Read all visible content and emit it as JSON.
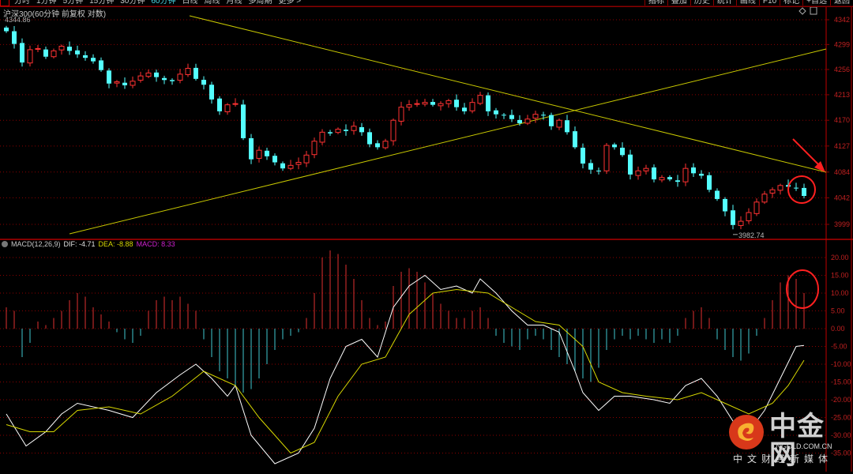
{
  "toolbar": {
    "periods": [
      "分时",
      "1分钟",
      "5分钟",
      "15分钟",
      "30分钟",
      "60分钟",
      "日线",
      "周线",
      "月线",
      "多周期",
      "更多 >"
    ],
    "active_period": "60分钟",
    "right_buttons": [
      "指标",
      "叠加",
      "历史",
      "统计",
      "画线",
      "F10",
      "标记",
      "+自选",
      "返回"
    ]
  },
  "title": "沪深300(60分钟 前复权 对数)",
  "max_label": "4344.86",
  "min_label": "3982.74",
  "macd_legend": {
    "name": "MACD(12,26,9)",
    "dif": "DIF: -4.71",
    "dea": "DEA: -8.88",
    "macd": "MACD: 8.33"
  },
  "logo": {
    "name": "中金网",
    "domain": "CNGOLD.COM.CN",
    "slogan": "中文财经新媒体"
  },
  "colors": {
    "up": "#ff3232",
    "down": "#54ffff",
    "dif": "#ffffff",
    "dea": "#d8d800",
    "grid": "#8b0000",
    "axis_text": "#c02020",
    "trendline": "#c8c800",
    "annotation": "#ff2020"
  },
  "chart_data": [
    {
      "type": "candlestick",
      "title": "沪深300",
      "y_ticks": [
        4342,
        4299,
        4256,
        4213,
        4170,
        4127,
        4084,
        4042,
        3999
      ],
      "ylim": [
        3982,
        4345
      ],
      "y_scale": "log",
      "grid": true,
      "close": [
        4322,
        4300,
        4268,
        4290,
        4292,
        4278,
        4288,
        4296,
        4288,
        4282,
        4276,
        4270,
        4255,
        4232,
        4235,
        4229,
        4236,
        4245,
        4250,
        4243,
        4238,
        4236,
        4248,
        4258,
        4240,
        4230,
        4205,
        4185,
        4196,
        4198,
        4140,
        4105,
        4120,
        4110,
        4100,
        4090,
        4095,
        4100,
        4112,
        4135,
        4150,
        4148,
        4155,
        4152,
        4160,
        4150,
        4130,
        4125,
        4135,
        4170,
        4192,
        4196,
        4198,
        4200,
        4196,
        4198,
        4203,
        4192,
        4185,
        4200,
        4212,
        4185,
        4180,
        4178,
        4172,
        4165,
        4172,
        4180,
        4178,
        4160,
        4170,
        4150,
        4125,
        4098,
        4088,
        4086,
        4128,
        4125,
        4112,
        4080,
        4086,
        4090,
        4072,
        4075,
        4072,
        4068,
        4090,
        4082,
        4078,
        4055,
        4040,
        4020,
        3998,
        4004,
        4018,
        4035,
        4048,
        4055,
        4062,
        4060,
        4058,
        4045
      ]
    },
    {
      "type": "bar+line",
      "title": "MACD(12,26,9)",
      "y_ticks": [
        20,
        15,
        10,
        5,
        0,
        -5,
        -10,
        -15,
        -20,
        -25,
        -30,
        -35
      ],
      "ylim": [
        -40,
        22
      ],
      "macd": [
        6,
        5,
        -8,
        -4,
        2,
        1,
        3,
        5,
        8,
        10,
        9,
        6,
        4,
        2,
        -1,
        -3,
        -4,
        -2,
        5,
        8,
        9,
        8,
        9,
        7,
        5,
        -3,
        -8,
        -12,
        -14,
        -16,
        -18,
        -17,
        -14,
        -10,
        -6,
        -3,
        -2,
        -1,
        3,
        10,
        20,
        22,
        21,
        18,
        14,
        8,
        3,
        1,
        2,
        12,
        16,
        17,
        16,
        13,
        10,
        7,
        5,
        3,
        3,
        5,
        6,
        3,
        -2,
        -4,
        -5,
        -6,
        -3,
        -2,
        -3,
        -6,
        -8,
        -10,
        -12,
        -14,
        -15,
        -11,
        -6,
        -3,
        -2,
        -3,
        -2,
        -3,
        -4,
        -3,
        -4,
        -2,
        3,
        5,
        6,
        3,
        -3,
        -6,
        -8,
        -9,
        -7,
        -2,
        3,
        8,
        13,
        15,
        14,
        10
      ],
      "dif": [
        [
          0,
          -24
        ],
        [
          2.5,
          -33
        ],
        [
          5,
          -29
        ],
        [
          7,
          -24
        ],
        [
          9,
          -21
        ],
        [
          13,
          -23
        ],
        [
          16,
          -25
        ],
        [
          19,
          -18
        ],
        [
          22,
          -13
        ],
        [
          24,
          -10
        ],
        [
          26,
          -14
        ],
        [
          28,
          -19
        ],
        [
          29,
          -16
        ],
        [
          31,
          -30
        ],
        [
          34,
          -38
        ],
        [
          37,
          -35
        ],
        [
          39,
          -28
        ],
        [
          41,
          -14
        ],
        [
          43,
          -5
        ],
        [
          45,
          -3
        ],
        [
          47,
          -8
        ],
        [
          49,
          6
        ],
        [
          51,
          12
        ],
        [
          53,
          15
        ],
        [
          55,
          11
        ],
        [
          57,
          12
        ],
        [
          59,
          10
        ],
        [
          60,
          14
        ],
        [
          62,
          10
        ],
        [
          64,
          5
        ],
        [
          66,
          1
        ],
        [
          68,
          1
        ],
        [
          70,
          -1
        ],
        [
          72,
          -12
        ],
        [
          73,
          -18
        ],
        [
          75,
          -23
        ],
        [
          77,
          -19
        ],
        [
          79,
          -19
        ],
        [
          82,
          -20
        ],
        [
          84,
          -21
        ],
        [
          86,
          -16
        ],
        [
          88,
          -14
        ],
        [
          90,
          -19
        ],
        [
          92,
          -26
        ],
        [
          94,
          -29
        ],
        [
          96,
          -23
        ],
        [
          98,
          -14
        ],
        [
          100,
          -5
        ],
        [
          101,
          -4.71
        ]
      ],
      "dea": [
        [
          0,
          -27
        ],
        [
          3,
          -29
        ],
        [
          6,
          -29
        ],
        [
          9,
          -23
        ],
        [
          13,
          -22
        ],
        [
          17,
          -24
        ],
        [
          21,
          -19
        ],
        [
          25,
          -12
        ],
        [
          29,
          -16
        ],
        [
          32,
          -25
        ],
        [
          36,
          -35
        ],
        [
          39,
          -32
        ],
        [
          42,
          -19
        ],
        [
          45,
          -10
        ],
        [
          48,
          -8
        ],
        [
          51,
          4
        ],
        [
          54,
          10
        ],
        [
          57,
          11
        ],
        [
          61,
          10
        ],
        [
          64,
          6
        ],
        [
          67,
          2
        ],
        [
          70,
          1
        ],
        [
          73,
          -5
        ],
        [
          75,
          -15
        ],
        [
          78,
          -18
        ],
        [
          81,
          -19
        ],
        [
          85,
          -20
        ],
        [
          88,
          -18
        ],
        [
          91,
          -21
        ],
        [
          94,
          -24
        ],
        [
          97,
          -21
        ],
        [
          99,
          -16
        ],
        [
          101,
          -8.88
        ]
      ]
    }
  ]
}
